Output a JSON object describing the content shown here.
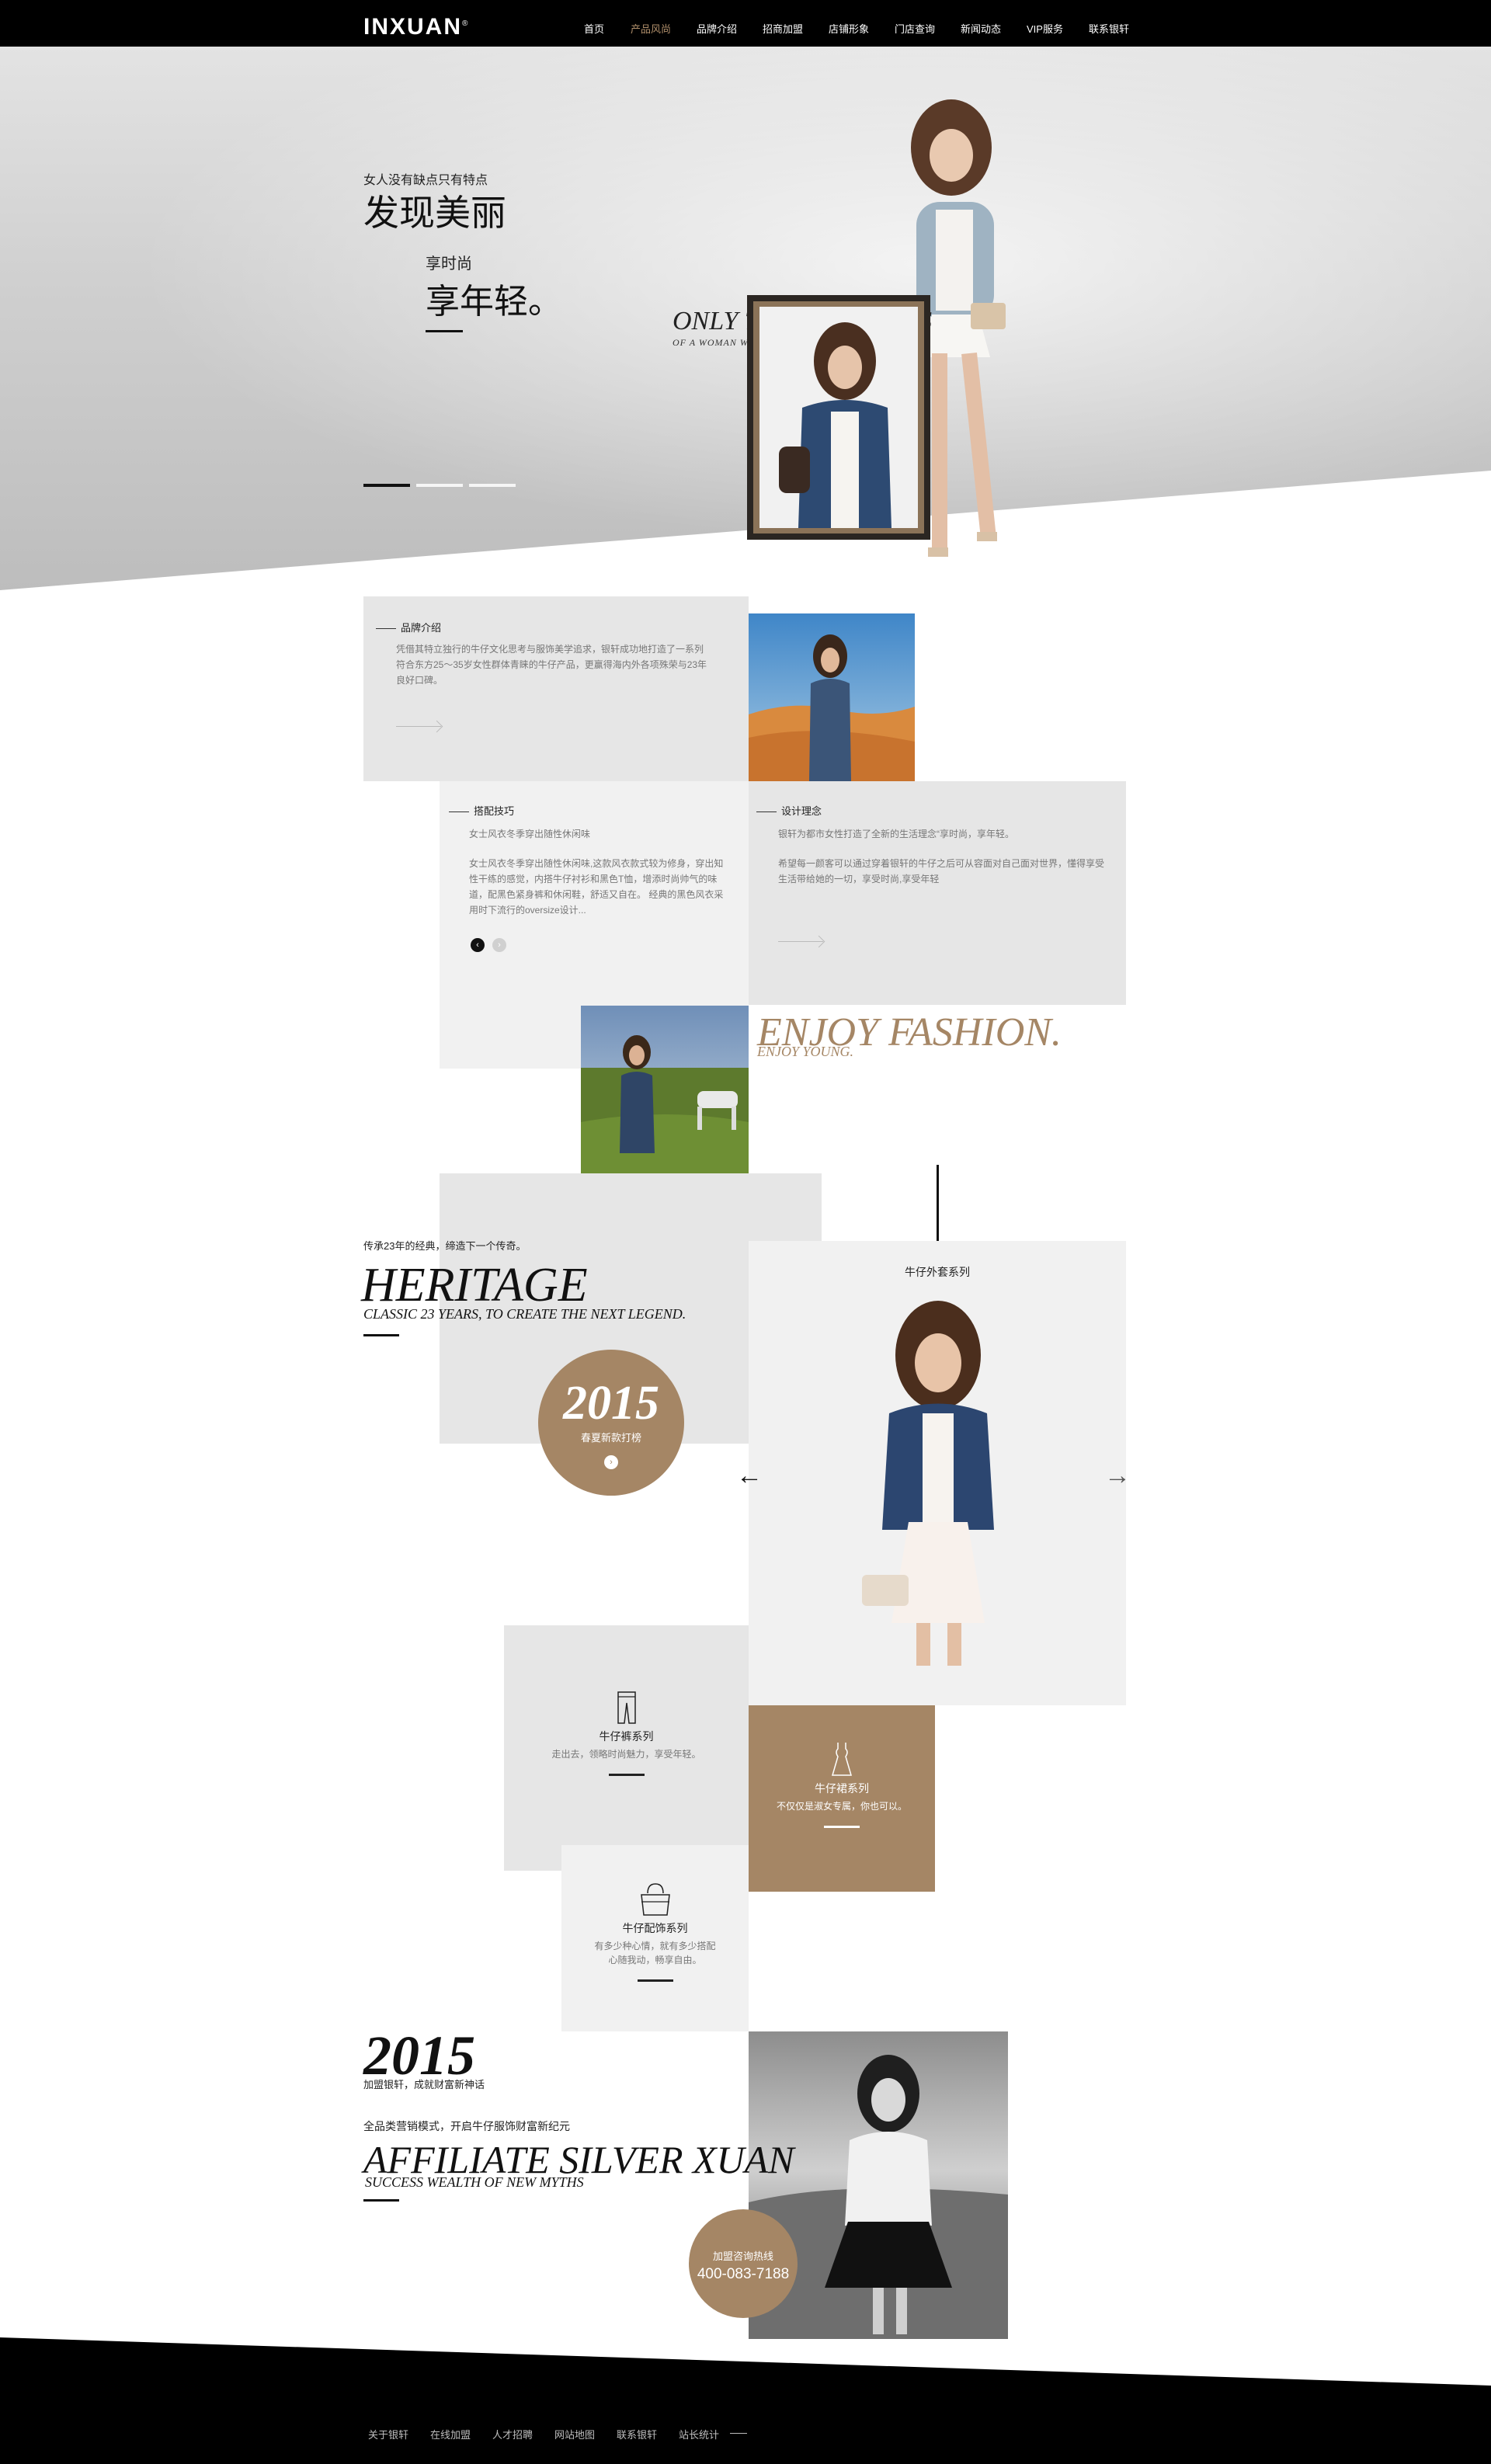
{
  "brand": {
    "logo": "INXUAN",
    "reg": "®"
  },
  "nav": {
    "items": [
      "首页",
      "产品风尚",
      "品牌介绍",
      "招商加盟",
      "店铺形象",
      "门店查询",
      "新闻动态",
      "VIP服务",
      "联系银轩"
    ],
    "active_index": 1
  },
  "hero": {
    "sub1": "女人没有缺点只有特点",
    "title1": "发现美丽",
    "sub2": "享时尚",
    "title2": "享年轻。",
    "en_title": "ONLY THE CHARA        ICS",
    "en_sub": "OF A WOMAN WITHOUT DRAWBACKS",
    "slide_count": 3,
    "active_slide": 0
  },
  "brand_intro": {
    "title": "品牌介绍",
    "text": "凭借其特立独行的牛仔文化思考与服饰美学追求，银轩成功地打造了一系列符合东方25～35岁女性群体青睐的牛仔产品，更赢得海内外各项殊荣与23年良好口碑。"
  },
  "styling": {
    "title": "搭配技巧",
    "lead": "女士风衣冬季穿出随性休闲味",
    "text": "女士风衣冬季穿出随性休闲味,这款风衣款式较为修身，穿出知性干练的感觉，内搭牛仔衬衫和黑色T恤，增添时尚帅气的味道，配黑色紧身裤和休闲鞋，舒适又自在。    经典的黑色风衣采用时下流行的oversize设计..."
  },
  "design": {
    "title": "设计理念",
    "text1": "银轩为都市女性打造了全新的生活理念“享时尚，享年轻。",
    "text2": "希望每一颜客可以通过穿着银轩的牛仔之后可从容面对自己面对世界，懂得享受生活带给她的一切，享受时尚,享受年轻"
  },
  "enjoy": {
    "title": "ENJOY FASHION.",
    "sub": "ENJOY YOUNG."
  },
  "heritage": {
    "sub": "传承23年的经典，缔造下一个传奇。",
    "title": "HERITAGE",
    "en": "CLASSIC 23 YEARS, TO CREATE THE NEXT LEGEND.",
    "circle_year": "2015",
    "circle_caption": "春夏新款打榜",
    "circle_btn": "›"
  },
  "series": {
    "title": "牛仔外套系列",
    "prev": "←",
    "next": "→"
  },
  "categories": [
    {
      "title": "牛仔裤系列",
      "desc": "走出去，领略时尚魅力，享受年轻。",
      "icon": "jeans-icon"
    },
    {
      "title": "牛仔裙系列",
      "desc": "不仅仅是淑女专属，你也可以。",
      "icon": "dress-icon"
    },
    {
      "title": "牛仔配饰系列",
      "desc1": "有多少种心情，就有多少搭配",
      "desc2": "心随我动，畅享自由。",
      "icon": "handbag-icon"
    }
  ],
  "affiliate": {
    "year": "2015",
    "year_sub": "加盟银轩，成就财富新神话",
    "sub": "全品类营销模式，开启牛仔服饰财富新纪元",
    "title": "AFFILIATE SILVER XUAN",
    "en": "SUCCESS WEALTH OF NEW MYTHS",
    "hotline_label": "加盟咨询热线",
    "hotline": "400-083-7188"
  },
  "footer": {
    "links": [
      "关于银轩",
      "在线加盟",
      "人才招聘",
      "网站地图",
      "联系银轩",
      "站长统计"
    ]
  },
  "colors": {
    "accent": "#a58665",
    "black": "#000000",
    "grey": "#e6e6e6"
  }
}
